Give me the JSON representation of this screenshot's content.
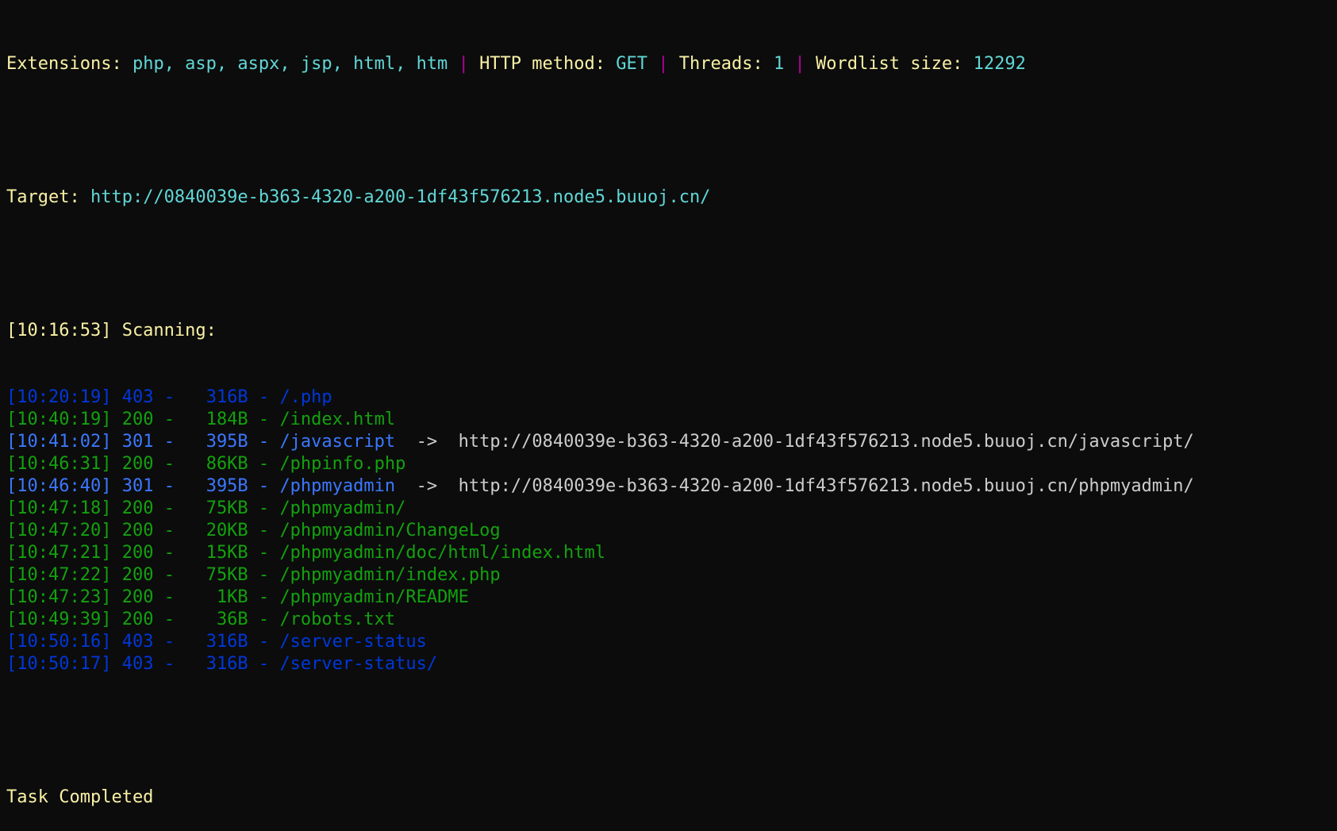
{
  "header": {
    "extensions_label": "Extensions:",
    "extensions_value": "php, asp, aspx, jsp, html, htm",
    "method_label": "HTTP method:",
    "method_value": "GET",
    "threads_label": "Threads:",
    "threads_value": "1",
    "wordlist_label": "Wordlist size:",
    "wordlist_value": "12292",
    "separator": "|"
  },
  "target": {
    "label": "Target:",
    "url": "http://0840039e-b363-4320-a200-1df43f576213.node5.buuoj.cn/"
  },
  "scan_start": "[10:16:53] Scanning:",
  "results": [
    {
      "time": "[10:20:19]",
      "code": "403",
      "size": "316B",
      "path": "/.php",
      "redirect": "",
      "color": "#0037da"
    },
    {
      "time": "[10:40:19]",
      "code": "200",
      "size": "184B",
      "path": "/index.html",
      "redirect": "",
      "color": "#13a10e"
    },
    {
      "time": "[10:41:02]",
      "code": "301",
      "size": "395B",
      "path": "/javascript",
      "redirect": "http://0840039e-b363-4320-a200-1df43f576213.node5.buuoj.cn/javascript/",
      "color": "#3b78ff"
    },
    {
      "time": "[10:46:31]",
      "code": "200",
      "size": "86KB",
      "path": "/phpinfo.php",
      "redirect": "",
      "color": "#13a10e"
    },
    {
      "time": "[10:46:40]",
      "code": "301",
      "size": "395B",
      "path": "/phpmyadmin",
      "redirect": "http://0840039e-b363-4320-a200-1df43f576213.node5.buuoj.cn/phpmyadmin/",
      "color": "#3b78ff"
    },
    {
      "time": "[10:47:18]",
      "code": "200",
      "size": "75KB",
      "path": "/phpmyadmin/",
      "redirect": "",
      "color": "#13a10e"
    },
    {
      "time": "[10:47:20]",
      "code": "200",
      "size": "20KB",
      "path": "/phpmyadmin/ChangeLog",
      "redirect": "",
      "color": "#13a10e"
    },
    {
      "time": "[10:47:21]",
      "code": "200",
      "size": "15KB",
      "path": "/phpmyadmin/doc/html/index.html",
      "redirect": "",
      "color": "#13a10e"
    },
    {
      "time": "[10:47:22]",
      "code": "200",
      "size": "75KB",
      "path": "/phpmyadmin/index.php",
      "redirect": "",
      "color": "#13a10e"
    },
    {
      "time": "[10:47:23]",
      "code": "200",
      "size": "1KB",
      "path": "/phpmyadmin/README",
      "redirect": "",
      "color": "#13a10e"
    },
    {
      "time": "[10:49:39]",
      "code": "200",
      "size": "36B",
      "path": "/robots.txt",
      "redirect": "",
      "color": "#13a10e"
    },
    {
      "time": "[10:50:16]",
      "code": "403",
      "size": "316B",
      "path": "/server-status",
      "redirect": "",
      "color": "#0037da"
    },
    {
      "time": "[10:50:17]",
      "code": "403",
      "size": "316B",
      "path": "/server-status/",
      "redirect": "",
      "color": "#0037da"
    }
  ],
  "completion": "Task Completed",
  "arrow": "->",
  "dash": "-",
  "colors": {
    "background": "#0c0c0c",
    "label": "#f9f1a5",
    "value": "#61d6d6",
    "separator": "#b4009e",
    "code_403": "#0037da",
    "code_301": "#3b78ff",
    "code_200": "#13a10e",
    "redirect": "#cccccc"
  }
}
